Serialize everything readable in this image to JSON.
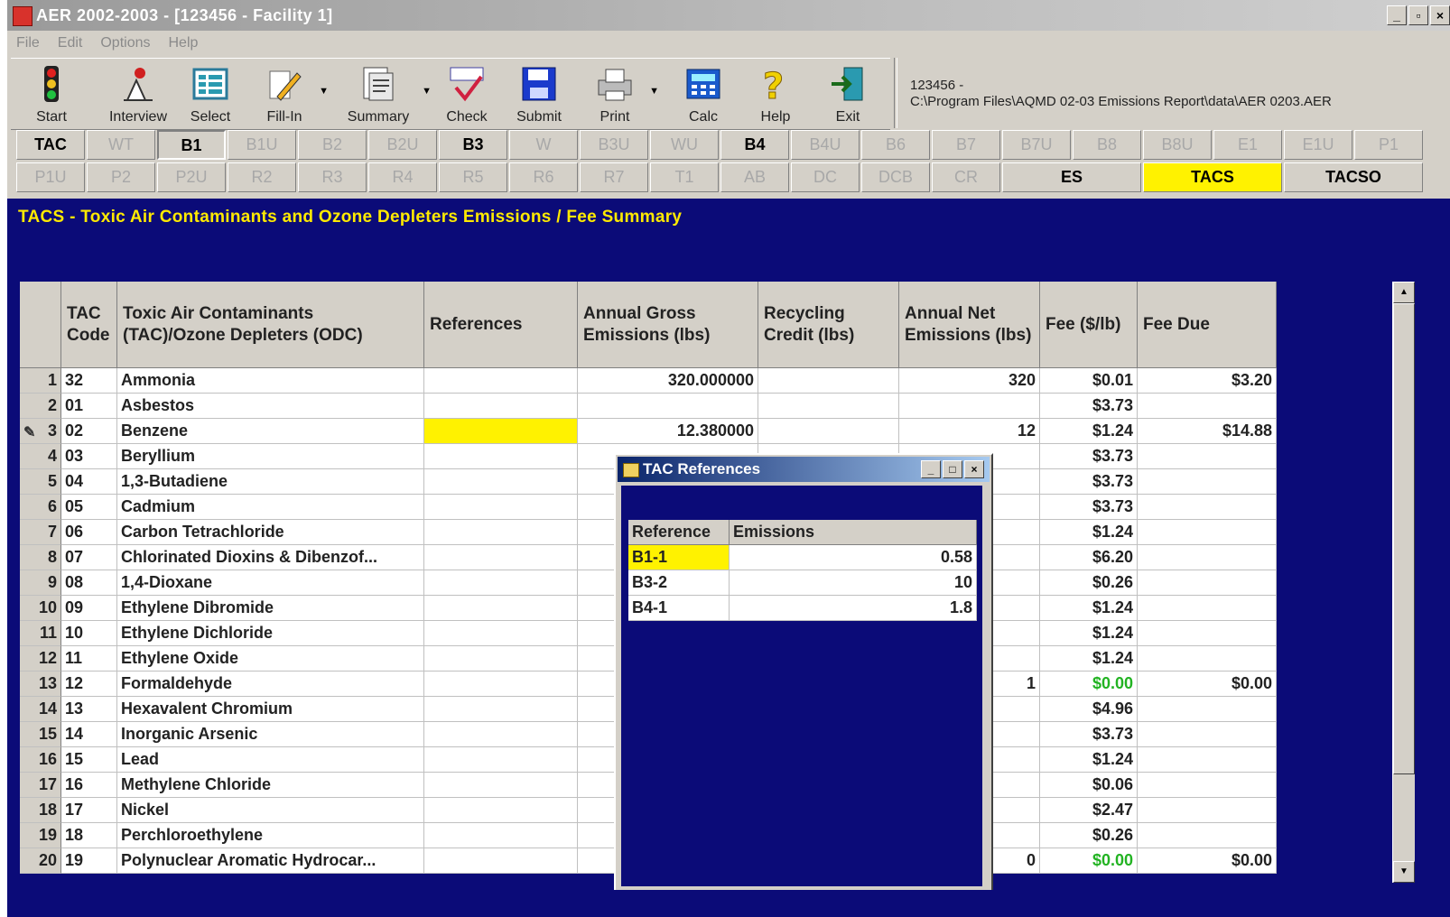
{
  "window": {
    "title": "AER 2002-2003 - [123456 - Facility 1]"
  },
  "menu": [
    "File",
    "Edit",
    "Options",
    "Help"
  ],
  "toolbar": [
    {
      "label": "Start",
      "icon": "traffic-light-icon"
    },
    {
      "label": "Interview",
      "icon": "interview-icon"
    },
    {
      "label": "Select",
      "icon": "select-icon"
    },
    {
      "label": "Fill-In",
      "icon": "pencil-icon"
    },
    {
      "label": "Summary",
      "icon": "summary-icon"
    },
    {
      "label": "Check",
      "icon": "error-check-icon"
    },
    {
      "label": "Submit",
      "icon": "floppy-icon"
    },
    {
      "label": "Print",
      "icon": "printer-icon"
    },
    {
      "label": "Calc",
      "icon": "calculator-icon"
    },
    {
      "label": "Help",
      "icon": "help-icon"
    },
    {
      "label": "Exit",
      "icon": "exit-icon"
    }
  ],
  "path_info": {
    "line1": "123456 -",
    "line2": "C:\\Program Files\\AQMD 02-03 Emissions Report\\data\\AER 0203.AER"
  },
  "tabs_row1": [
    "TAC",
    "WT",
    "B1",
    "B1U",
    "B2",
    "B2U",
    "B3",
    "W",
    "B3U",
    "WU",
    "B4",
    "B4U",
    "B6",
    "B7",
    "B7U",
    "B8",
    "B8U",
    "E1",
    "E1U",
    "P1"
  ],
  "tabs_row2": [
    "P1U",
    "P2",
    "P2U",
    "R2",
    "R3",
    "R4",
    "R5",
    "R6",
    "R7",
    "T1",
    "AB",
    "DC",
    "DCB",
    "CR",
    "ES",
    "TACS",
    "TACSO"
  ],
  "panel": {
    "title": "TACS - Toxic Air Contaminants and Ozone Depleters Emissions / Fee Summary"
  },
  "grid": {
    "headers": {
      "code": "TAC Code",
      "name": "Toxic Air Contaminants (TAC)/Ozone Depleters (ODC)",
      "refs": "References",
      "gross": "Annual Gross Emissions (lbs)",
      "recycling": "Recycling Credit (lbs)",
      "net": "Annual Net Emissions (lbs)",
      "fee": "Fee ($/lb)",
      "due": "Fee Due"
    },
    "rows": [
      {
        "n": "1",
        "code": "32",
        "name": "Ammonia",
        "gross": "320.000000",
        "net": "320",
        "fee": "$0.01",
        "due": "$3.20"
      },
      {
        "n": "2",
        "code": "01",
        "name": "Asbestos",
        "gross": "",
        "net": "",
        "fee": "$3.73",
        "due": ""
      },
      {
        "n": "3",
        "code": "02",
        "name": "Benzene",
        "gross": "12.380000",
        "net": "12",
        "fee": "$1.24",
        "due": "$14.88"
      },
      {
        "n": "4",
        "code": "03",
        "name": "Beryllium",
        "gross": "",
        "net": "",
        "fee": "$3.73",
        "due": ""
      },
      {
        "n": "5",
        "code": "04",
        "name": "1,3-Butadiene",
        "gross": "",
        "net": "",
        "fee": "$3.73",
        "due": ""
      },
      {
        "n": "6",
        "code": "05",
        "name": "Cadmium",
        "gross": "",
        "net": "",
        "fee": "$3.73",
        "due": ""
      },
      {
        "n": "7",
        "code": "06",
        "name": "Carbon Tetrachloride",
        "gross": "",
        "net": "",
        "fee": "$1.24",
        "due": ""
      },
      {
        "n": "8",
        "code": "07",
        "name": "Chlorinated Dioxins & Dibenzof...",
        "gross": "",
        "net": "",
        "fee": "$6.20",
        "due": ""
      },
      {
        "n": "9",
        "code": "08",
        "name": "1,4-Dioxane",
        "gross": "",
        "net": "",
        "fee": "$0.26",
        "due": ""
      },
      {
        "n": "10",
        "code": "09",
        "name": "Ethylene Dibromide",
        "gross": "",
        "net": "",
        "fee": "$1.24",
        "due": ""
      },
      {
        "n": "11",
        "code": "10",
        "name": "Ethylene Dichloride",
        "gross": "",
        "net": "",
        "fee": "$1.24",
        "due": ""
      },
      {
        "n": "12",
        "code": "11",
        "name": "Ethylene Oxide",
        "gross": "",
        "net": "",
        "fee": "$1.24",
        "due": ""
      },
      {
        "n": "13",
        "code": "12",
        "name": "Formaldehyde",
        "gross": "",
        "net": "1",
        "fee": "$0.00",
        "due": "$0.00"
      },
      {
        "n": "14",
        "code": "13",
        "name": "Hexavalent Chromium",
        "gross": "",
        "net": "",
        "fee": "$4.96",
        "due": ""
      },
      {
        "n": "15",
        "code": "14",
        "name": "Inorganic Arsenic",
        "gross": "",
        "net": "",
        "fee": "$3.73",
        "due": ""
      },
      {
        "n": "16",
        "code": "15",
        "name": "Lead",
        "gross": "",
        "net": "",
        "fee": "$1.24",
        "due": ""
      },
      {
        "n": "17",
        "code": "16",
        "name": "Methylene Chloride",
        "gross": "",
        "net": "",
        "fee": "$0.06",
        "due": ""
      },
      {
        "n": "18",
        "code": "17",
        "name": "Nickel",
        "gross": "",
        "net": "",
        "fee": "$2.47",
        "due": ""
      },
      {
        "n": "19",
        "code": "18",
        "name": "Perchloroethylene",
        "gross": "",
        "net": "",
        "fee": "$0.26",
        "due": ""
      },
      {
        "n": "20",
        "code": "19",
        "name": "Polynuclear Aromatic Hydrocar...",
        "gross": "",
        "net": "0",
        "fee": "$0.00",
        "due": "$0.00"
      }
    ]
  },
  "dialog": {
    "title": "TAC References",
    "headers": {
      "ref": "Reference",
      "emissions": "Emissions"
    },
    "rows": [
      {
        "ref": "B1-1",
        "emissions": "0.58"
      },
      {
        "ref": "B3-2",
        "emissions": "10"
      },
      {
        "ref": "B4-1",
        "emissions": "1.8"
      }
    ]
  },
  "colors": {
    "panel_bg": "#0b0b78",
    "title_yellow": "#ffea00",
    "highlight_yellow": "#fff200",
    "fee_green": "#22b322",
    "window_gray": "#d4d0c8"
  }
}
